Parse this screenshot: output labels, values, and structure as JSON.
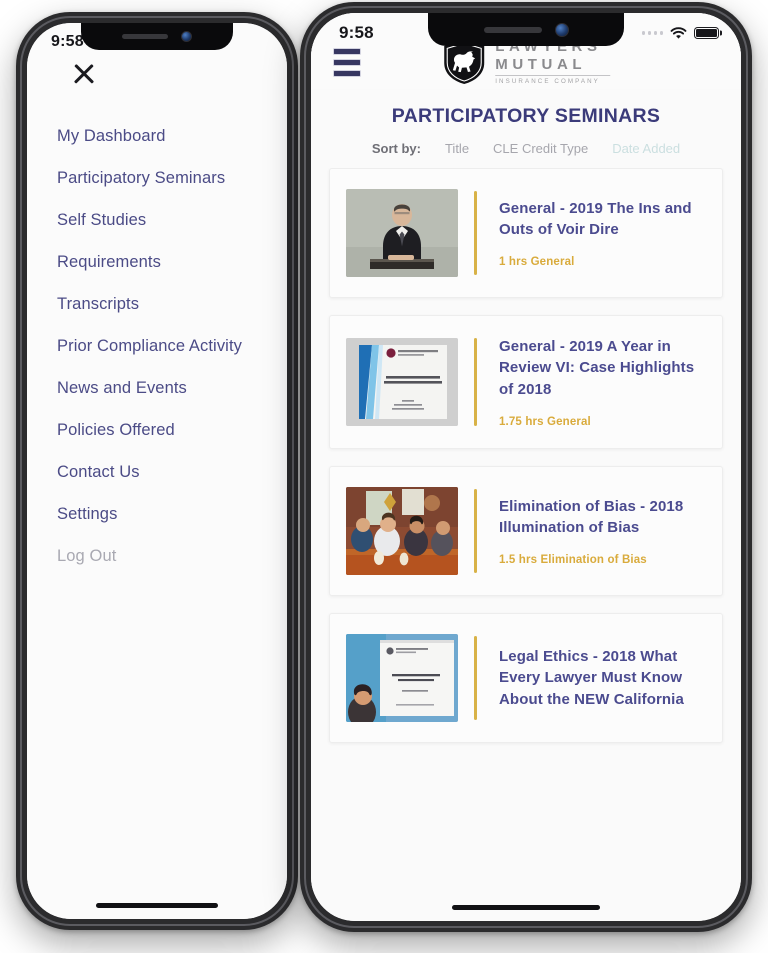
{
  "drawer": {
    "status": {
      "time": "9:58"
    },
    "close_icon": "close-icon",
    "items": [
      {
        "label": "My Dashboard",
        "muted": false
      },
      {
        "label": "Participatory Seminars",
        "muted": false
      },
      {
        "label": "Self Studies",
        "muted": false
      },
      {
        "label": "Requirements",
        "muted": false
      },
      {
        "label": "Transcripts",
        "muted": false
      },
      {
        "label": "Prior Compliance Activity",
        "muted": false
      },
      {
        "label": "News and Events",
        "muted": false
      },
      {
        "label": "Policies Offered",
        "muted": false
      },
      {
        "label": "Contact Us",
        "muted": false
      },
      {
        "label": "Settings",
        "muted": false
      },
      {
        "label": "Log Out",
        "muted": true
      }
    ]
  },
  "app": {
    "status": {
      "time": "9:58"
    },
    "menu_icon": "hamburger-menu-icon",
    "logo": {
      "mark": "bear-shield-icon",
      "line1": "LAWYERS'",
      "line2": "MUTUAL",
      "line3": "INSURANCE COMPANY"
    },
    "page_title": "PARTICIPATORY SEMINARS",
    "sort": {
      "label": "Sort by:",
      "options": [
        {
          "label": "Title",
          "active": false
        },
        {
          "label": "CLE Credit Type",
          "active": false
        },
        {
          "label": "Date Added",
          "active": true
        }
      ]
    },
    "seminars": [
      {
        "title": "General - 2019 The Ins and Outs of Voir Dire",
        "credit": "1 hrs General",
        "thumb": "speaker-at-podium-photo"
      },
      {
        "title": "General - 2019 A Year in Review VI: Case Highlights of 2018",
        "credit": "1.75 hrs General",
        "thumb": "presentation-slide-photo"
      },
      {
        "title": "Elimination of Bias - 2018 Illumination of Bias",
        "credit": "1.5 hrs Elimination of Bias",
        "thumb": "panel-discussion-photo"
      },
      {
        "title": "Legal Ethics - 2018 What Every Lawyer Must Know About the NEW California",
        "credit": "",
        "thumb": "seminar-slide-photo"
      }
    ]
  },
  "colors": {
    "accent_navy": "#4b4b8f",
    "accent_gold": "#d9ab3c",
    "title_navy": "#3b3b7a",
    "menu_text": "#4b4b86",
    "muted_text": "#a9a9b2",
    "sort_active": "#cbdfe0"
  }
}
